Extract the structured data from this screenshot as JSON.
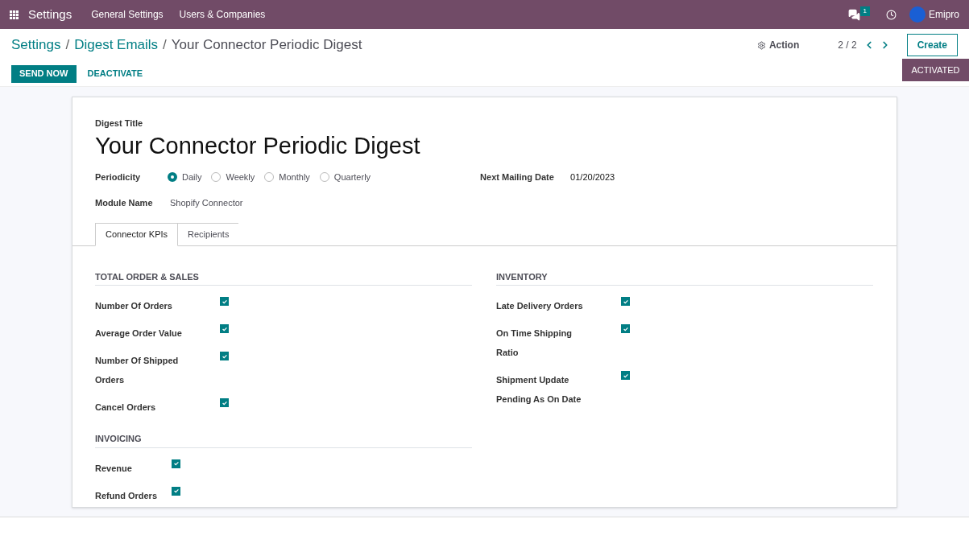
{
  "navbar": {
    "app": "Settings",
    "menus": [
      "General Settings",
      "Users & Companies"
    ],
    "chat_count": "1",
    "user": "Emipro"
  },
  "breadcrumb_separators": [
    "/",
    "/"
  ],
  "breadcrumbs": [
    {
      "label": "Settings",
      "link": true
    },
    {
      "label": "Digest Emails",
      "link": true
    },
    {
      "label": "Your Connector Periodic Digest",
      "link": false
    }
  ],
  "action": "Action",
  "pager": "2 / 2",
  "create": "Create",
  "buttons": [
    {
      "label": "SEND NOW",
      "kind": "primary"
    },
    {
      "label": "DEACTIVATE",
      "kind": "link"
    }
  ],
  "status": "ACTIVATED",
  "form": {
    "title_label": "Digest Title",
    "title": "Your Connector Periodic Digest",
    "periodicity": {
      "label": "Periodicity",
      "options": [
        {
          "label": "Daily",
          "selected": true
        },
        {
          "label": "Weekly",
          "selected": false
        },
        {
          "label": "Monthly",
          "selected": false
        },
        {
          "label": "Quarterly",
          "selected": false
        }
      ]
    },
    "next_mailing": {
      "label": "Next Mailing Date",
      "value": "01/20/2023"
    },
    "module": {
      "label": "Module Name",
      "value": "Shopify Connector"
    },
    "tabs": [
      {
        "label": "Connector KPIs",
        "selected": true
      },
      {
        "label": "Recipients",
        "selected": false
      }
    ],
    "columns": [
      {
        "sections": [
          {
            "title": "TOTAL ORDER & SALES",
            "items": [
              {
                "label": "Number Of Orders",
                "checked": true
              },
              {
                "label": "Average Order Value",
                "checked": true
              },
              {
                "label": "Number Of Shipped Orders",
                "checked": true
              },
              {
                "label": "Cancel Orders",
                "checked": true
              }
            ]
          },
          {
            "title": "INVOICING",
            "items": [
              {
                "label": "Revenue",
                "checked": true
              },
              {
                "label": "Refund Orders",
                "checked": true
              }
            ]
          }
        ]
      },
      {
        "sections": [
          {
            "title": "INVENTORY",
            "items": [
              {
                "label": "Late Delivery Orders",
                "checked": true
              },
              {
                "label": "On Time Shipping Ratio",
                "checked": true
              },
              {
                "label": "Shipment Update Pending As On Date",
                "checked": true
              }
            ]
          }
        ]
      }
    ]
  }
}
